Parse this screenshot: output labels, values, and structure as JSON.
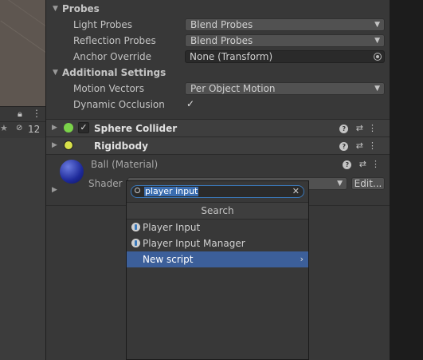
{
  "left_pane": {
    "visibility_count": "12"
  },
  "probes": {
    "title": "Probes",
    "light_probes": {
      "label": "Light Probes",
      "value": "Blend Probes"
    },
    "reflection_probes": {
      "label": "Reflection Probes",
      "value": "Blend Probes"
    },
    "anchor_override": {
      "label": "Anchor Override",
      "value": "None (Transform)"
    }
  },
  "additional_settings": {
    "title": "Additional Settings",
    "motion_vectors": {
      "label": "Motion Vectors",
      "value": "Per Object Motion"
    },
    "dynamic_occlusion": {
      "label": "Dynamic Occlusion",
      "checked": true,
      "check_glyph": "✓"
    }
  },
  "components": {
    "sphere_collider": {
      "title": "Sphere Collider",
      "check_glyph": "✓"
    },
    "rigidbody": {
      "title": "Rigidbody"
    }
  },
  "material": {
    "name": "Ball (Material)",
    "shader_label": "Shader",
    "edit_label": "Edit..."
  },
  "popup": {
    "search_value": "player input",
    "header": "Search",
    "items": [
      {
        "label": "Player Input",
        "icon": "script-icon"
      },
      {
        "label": "Player Input Manager",
        "icon": "script-icon"
      },
      {
        "label": "New script",
        "selected": true
      }
    ]
  },
  "colors": {
    "selection": "#3c5f9a",
    "search_focus": "#3a79bb"
  }
}
